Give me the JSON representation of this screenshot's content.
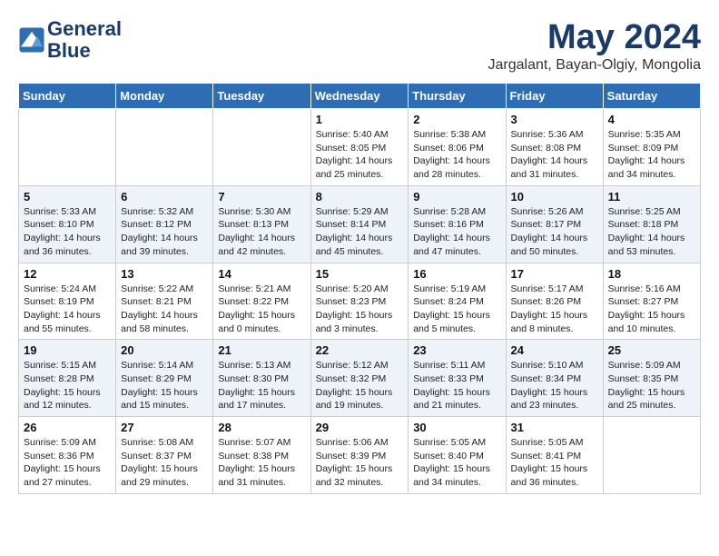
{
  "header": {
    "logo_line1": "General",
    "logo_line2": "Blue",
    "month": "May 2024",
    "location": "Jargalant, Bayan-Olgiy, Mongolia"
  },
  "days_of_week": [
    "Sunday",
    "Monday",
    "Tuesday",
    "Wednesday",
    "Thursday",
    "Friday",
    "Saturday"
  ],
  "weeks": [
    [
      {
        "num": "",
        "info": ""
      },
      {
        "num": "",
        "info": ""
      },
      {
        "num": "",
        "info": ""
      },
      {
        "num": "1",
        "info": "Sunrise: 5:40 AM\nSunset: 8:05 PM\nDaylight: 14 hours\nand 25 minutes."
      },
      {
        "num": "2",
        "info": "Sunrise: 5:38 AM\nSunset: 8:06 PM\nDaylight: 14 hours\nand 28 minutes."
      },
      {
        "num": "3",
        "info": "Sunrise: 5:36 AM\nSunset: 8:08 PM\nDaylight: 14 hours\nand 31 minutes."
      },
      {
        "num": "4",
        "info": "Sunrise: 5:35 AM\nSunset: 8:09 PM\nDaylight: 14 hours\nand 34 minutes."
      }
    ],
    [
      {
        "num": "5",
        "info": "Sunrise: 5:33 AM\nSunset: 8:10 PM\nDaylight: 14 hours\nand 36 minutes."
      },
      {
        "num": "6",
        "info": "Sunrise: 5:32 AM\nSunset: 8:12 PM\nDaylight: 14 hours\nand 39 minutes."
      },
      {
        "num": "7",
        "info": "Sunrise: 5:30 AM\nSunset: 8:13 PM\nDaylight: 14 hours\nand 42 minutes."
      },
      {
        "num": "8",
        "info": "Sunrise: 5:29 AM\nSunset: 8:14 PM\nDaylight: 14 hours\nand 45 minutes."
      },
      {
        "num": "9",
        "info": "Sunrise: 5:28 AM\nSunset: 8:16 PM\nDaylight: 14 hours\nand 47 minutes."
      },
      {
        "num": "10",
        "info": "Sunrise: 5:26 AM\nSunset: 8:17 PM\nDaylight: 14 hours\nand 50 minutes."
      },
      {
        "num": "11",
        "info": "Sunrise: 5:25 AM\nSunset: 8:18 PM\nDaylight: 14 hours\nand 53 minutes."
      }
    ],
    [
      {
        "num": "12",
        "info": "Sunrise: 5:24 AM\nSunset: 8:19 PM\nDaylight: 14 hours\nand 55 minutes."
      },
      {
        "num": "13",
        "info": "Sunrise: 5:22 AM\nSunset: 8:21 PM\nDaylight: 14 hours\nand 58 minutes."
      },
      {
        "num": "14",
        "info": "Sunrise: 5:21 AM\nSunset: 8:22 PM\nDaylight: 15 hours\nand 0 minutes."
      },
      {
        "num": "15",
        "info": "Sunrise: 5:20 AM\nSunset: 8:23 PM\nDaylight: 15 hours\nand 3 minutes."
      },
      {
        "num": "16",
        "info": "Sunrise: 5:19 AM\nSunset: 8:24 PM\nDaylight: 15 hours\nand 5 minutes."
      },
      {
        "num": "17",
        "info": "Sunrise: 5:17 AM\nSunset: 8:26 PM\nDaylight: 15 hours\nand 8 minutes."
      },
      {
        "num": "18",
        "info": "Sunrise: 5:16 AM\nSunset: 8:27 PM\nDaylight: 15 hours\nand 10 minutes."
      }
    ],
    [
      {
        "num": "19",
        "info": "Sunrise: 5:15 AM\nSunset: 8:28 PM\nDaylight: 15 hours\nand 12 minutes."
      },
      {
        "num": "20",
        "info": "Sunrise: 5:14 AM\nSunset: 8:29 PM\nDaylight: 15 hours\nand 15 minutes."
      },
      {
        "num": "21",
        "info": "Sunrise: 5:13 AM\nSunset: 8:30 PM\nDaylight: 15 hours\nand 17 minutes."
      },
      {
        "num": "22",
        "info": "Sunrise: 5:12 AM\nSunset: 8:32 PM\nDaylight: 15 hours\nand 19 minutes."
      },
      {
        "num": "23",
        "info": "Sunrise: 5:11 AM\nSunset: 8:33 PM\nDaylight: 15 hours\nand 21 minutes."
      },
      {
        "num": "24",
        "info": "Sunrise: 5:10 AM\nSunset: 8:34 PM\nDaylight: 15 hours\nand 23 minutes."
      },
      {
        "num": "25",
        "info": "Sunrise: 5:09 AM\nSunset: 8:35 PM\nDaylight: 15 hours\nand 25 minutes."
      }
    ],
    [
      {
        "num": "26",
        "info": "Sunrise: 5:09 AM\nSunset: 8:36 PM\nDaylight: 15 hours\nand 27 minutes."
      },
      {
        "num": "27",
        "info": "Sunrise: 5:08 AM\nSunset: 8:37 PM\nDaylight: 15 hours\nand 29 minutes."
      },
      {
        "num": "28",
        "info": "Sunrise: 5:07 AM\nSunset: 8:38 PM\nDaylight: 15 hours\nand 31 minutes."
      },
      {
        "num": "29",
        "info": "Sunrise: 5:06 AM\nSunset: 8:39 PM\nDaylight: 15 hours\nand 32 minutes."
      },
      {
        "num": "30",
        "info": "Sunrise: 5:05 AM\nSunset: 8:40 PM\nDaylight: 15 hours\nand 34 minutes."
      },
      {
        "num": "31",
        "info": "Sunrise: 5:05 AM\nSunset: 8:41 PM\nDaylight: 15 hours\nand 36 minutes."
      },
      {
        "num": "",
        "info": ""
      }
    ]
  ]
}
